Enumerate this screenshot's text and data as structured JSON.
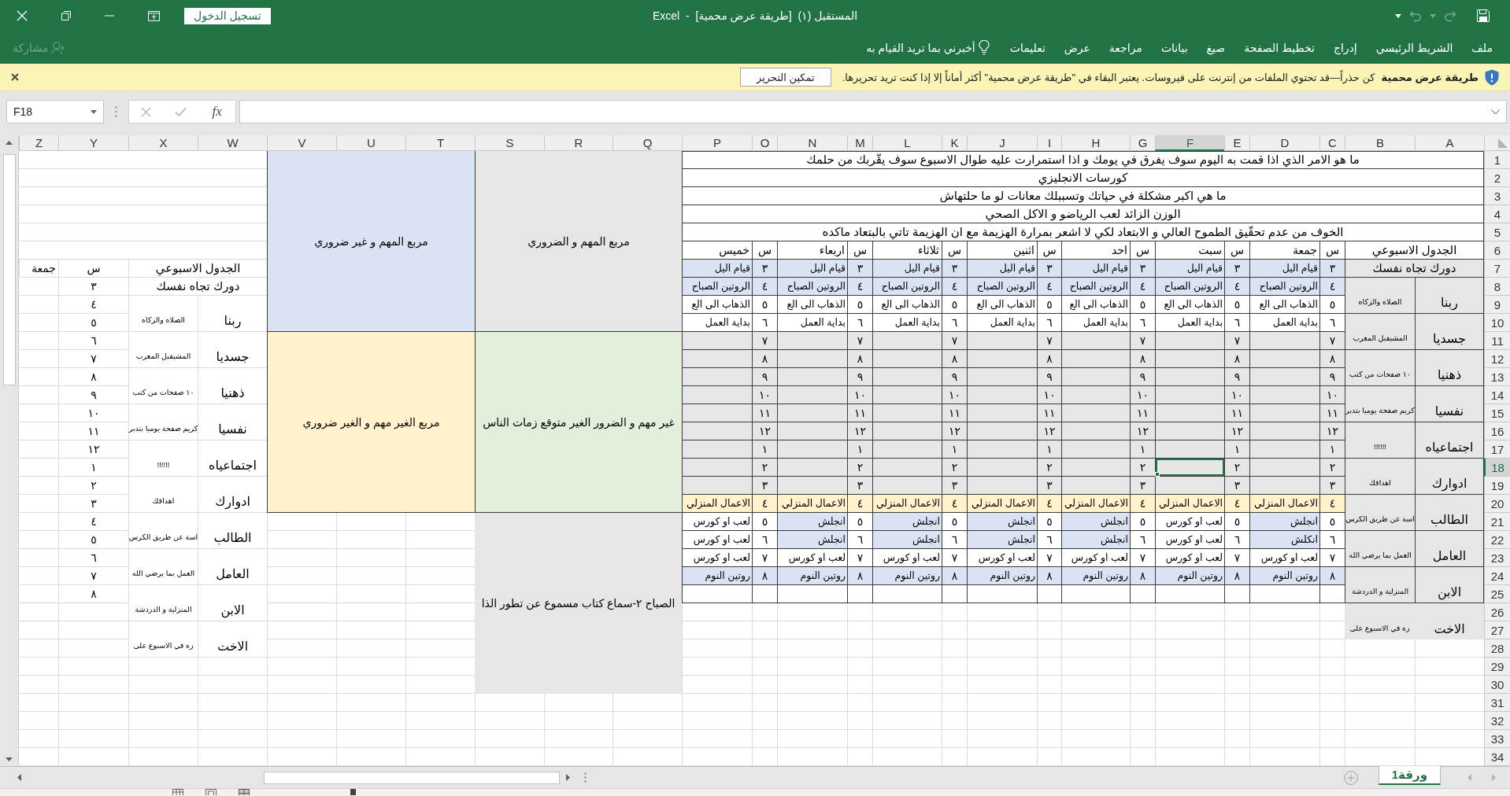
{
  "title_bar": {
    "sign_in": "تسجيل الدخول",
    "title": "المستقبل (١)  [طريقة عرض محمية]  -  Excel",
    "undo": {
      "disabled": true
    },
    "redo": {
      "disabled": true
    }
  },
  "ribbon": {
    "tabs": [
      {
        "label": "ملف",
        "selected": false
      },
      {
        "label": "الشريط الرئيسي",
        "selected": false
      },
      {
        "label": "إدراج",
        "selected": false
      },
      {
        "label": "تخطيط الصفحة",
        "selected": false
      },
      {
        "label": "صيغ",
        "selected": false
      },
      {
        "label": "بيانات",
        "selected": false
      },
      {
        "label": "مراجعة",
        "selected": false
      },
      {
        "label": "عرض",
        "selected": false
      },
      {
        "label": "تعليمات",
        "selected": false
      }
    ],
    "tell_me": "أخبرني بما تريد القيام به",
    "share": {
      "label": "مشاركة",
      "disabled": true
    }
  },
  "protected_view": {
    "title": "طريقة عرض محمية",
    "message": "كن حذراً—قد تحتوي الملفات من إنترنت على فيروسات. يعتبر البقاء في \"طريقة عرض محمية\" أكثر أماناً إلا إذا كنت تريد تحريرها.",
    "button": "تمكين التحرير"
  },
  "formula_bar": {
    "name_box": "F18",
    "cancel": {
      "disabled": true
    },
    "enter": {
      "disabled": true
    },
    "function_label": "fx"
  },
  "sheet": {
    "columns": [
      {
        "label": "A",
        "selected": false
      },
      {
        "label": "B",
        "selected": false
      },
      {
        "label": "C",
        "selected": false
      },
      {
        "label": "D",
        "selected": false
      },
      {
        "label": "E",
        "selected": false
      },
      {
        "label": "F",
        "selected": true
      },
      {
        "label": "G",
        "selected": false
      },
      {
        "label": "H",
        "selected": false
      },
      {
        "label": "I",
        "selected": false
      },
      {
        "label": "J",
        "selected": false
      },
      {
        "label": "K",
        "selected": false
      },
      {
        "label": "L",
        "selected": false
      },
      {
        "label": "M",
        "selected": false
      },
      {
        "label": "N",
        "selected": false
      },
      {
        "label": "O",
        "selected": false
      },
      {
        "label": "P",
        "selected": false
      },
      {
        "label": "Q",
        "selected": false
      },
      {
        "label": "R",
        "selected": false
      },
      {
        "label": "S",
        "selected": false
      },
      {
        "label": "T",
        "selected": false
      },
      {
        "label": "U",
        "selected": false
      },
      {
        "label": "V",
        "selected": false
      },
      {
        "label": "W",
        "selected": false
      },
      {
        "label": "X",
        "selected": false
      },
      {
        "label": "Y",
        "selected": false
      },
      {
        "label": "Z",
        "selected": false
      }
    ],
    "rows": [
      {
        "label": "1",
        "selected": false
      },
      {
        "label": "2",
        "selected": false
      },
      {
        "label": "3",
        "selected": false
      },
      {
        "label": "4",
        "selected": false
      },
      {
        "label": "5",
        "selected": false
      },
      {
        "label": "6",
        "selected": false
      },
      {
        "label": "7",
        "selected": false
      },
      {
        "label": "8",
        "selected": false
      },
      {
        "label": "9",
        "selected": false
      },
      {
        "label": "10",
        "selected": false
      },
      {
        "label": "11",
        "selected": false
      },
      {
        "label": "12",
        "selected": false
      },
      {
        "label": "13",
        "selected": false
      },
      {
        "label": "14",
        "selected": false
      },
      {
        "label": "15",
        "selected": false
      },
      {
        "label": "16",
        "selected": false
      },
      {
        "label": "17",
        "selected": false
      },
      {
        "label": "18",
        "selected": true
      },
      {
        "label": "19",
        "selected": false
      },
      {
        "label": "20",
        "selected": false
      },
      {
        "label": "21",
        "selected": false
      },
      {
        "label": "22",
        "selected": false
      },
      {
        "label": "23",
        "selected": false
      },
      {
        "label": "24",
        "selected": false
      },
      {
        "label": "25",
        "selected": false
      },
      {
        "label": "26",
        "selected": false
      },
      {
        "label": "27",
        "selected": false
      },
      {
        "label": "28",
        "selected": false
      },
      {
        "label": "29",
        "selected": false
      },
      {
        "label": "30",
        "selected": false
      },
      {
        "label": "31",
        "selected": false
      },
      {
        "label": "32",
        "selected": false
      },
      {
        "label": "33",
        "selected": false
      },
      {
        "label": "34",
        "selected": false
      }
    ],
    "questions": [
      "ما هو الامر الذي اذا قمت به اليوم سوف يفرق في يومك و اذا استمرارت عليه طوال الاسبوع سوف يقّربك من حلمك",
      "كورسات الانجليزي",
      "ما هي اكبر مشكلة في حياتك وتسببلك معانات لو ما حلتهاش",
      "الوزن الزائد لعب الرياضو و الاكل الصحي",
      "الخوف من عدم تحقّيق الطموح العالي و الابتعاد لكي لا اشعر بمرارة الهزيمة مع ان الهزيمة تاتي بالبتعاد ماكده"
    ],
    "schedule": {
      "title": "الجدول الاسبوعي",
      "subtitle": "دورك تجاه نفسك",
      "days": [
        {
          "hour_heading": "س",
          "name": "جمعة"
        },
        {
          "hour_heading": "س",
          "name": "سبت"
        },
        {
          "hour_heading": "س",
          "name": "احد"
        },
        {
          "hour_heading": "س",
          "name": "اثنين"
        },
        {
          "hour_heading": "س",
          "name": "ثلاثاء"
        },
        {
          "hour_heading": "س",
          "name": "اربعاء"
        },
        {
          "hour_heading": "س",
          "name": "خميس"
        }
      ],
      "rows": [
        {
          "cells": [
            {
              "kind": "hour",
              "text": "٣",
              "color": "#dae3f3"
            },
            {
              "kind": "activity",
              "text": "قيام اليل",
              "color": "#dae3f3"
            },
            {
              "kind": "hour",
              "text": "٣",
              "color": "#dae3f3"
            },
            {
              "kind": "activity",
              "text": "قيام اليل",
              "color": "#dae3f3"
            },
            {
              "kind": "hour",
              "text": "٣",
              "color": "#dae3f3"
            },
            {
              "kind": "activity",
              "text": "قيام اليل",
              "color": "#dae3f3"
            },
            {
              "kind": "hour",
              "text": "٣",
              "color": "#dae3f3"
            },
            {
              "kind": "activity",
              "text": "قيام اليل",
              "color": "#dae3f3"
            },
            {
              "kind": "hour",
              "text": "٣",
              "color": "#dae3f3"
            },
            {
              "kind": "activity",
              "text": "قيام اليل",
              "color": "#dae3f3"
            },
            {
              "kind": "hour",
              "text": "٣",
              "color": "#dae3f3"
            },
            {
              "kind": "activity",
              "text": "قيام اليل",
              "color": "#dae3f3"
            },
            {
              "kind": "hour",
              "text": "٣",
              "color": "#dae3f3"
            },
            {
              "kind": "activity",
              "text": "قيام اليل",
              "color": "#dae3f3"
            }
          ]
        },
        {
          "cells": [
            {
              "kind": "hour",
              "text": "٤",
              "color": "#dae3f3"
            },
            {
              "kind": "activity",
              "text": "الروتين الصباح",
              "color": "#dae3f3"
            },
            {
              "kind": "hour",
              "text": "٤",
              "color": "#dae3f3"
            },
            {
              "kind": "activity",
              "text": "الروتين الصباح",
              "color": "#dae3f3"
            },
            {
              "kind": "hour",
              "text": "٤",
              "color": "#dae3f3"
            },
            {
              "kind": "activity",
              "text": "الروتين الصباح",
              "color": "#dae3f3"
            },
            {
              "kind": "hour",
              "text": "٤",
              "color": "#dae3f3"
            },
            {
              "kind": "activity",
              "text": "الروتين الصباح",
              "color": "#dae3f3"
            },
            {
              "kind": "hour",
              "text": "٤",
              "color": "#dae3f3"
            },
            {
              "kind": "activity",
              "text": "الروتين الصباح",
              "color": "#dae3f3"
            },
            {
              "kind": "hour",
              "text": "٤",
              "color": "#dae3f3"
            },
            {
              "kind": "activity",
              "text": "الروتين الصباح",
              "color": "#dae3f3"
            },
            {
              "kind": "hour",
              "text": "٤",
              "color": "#dae3f3"
            },
            {
              "kind": "activity",
              "text": "الروتين الصباح",
              "color": "#dae3f3"
            }
          ]
        },
        {
          "cells": [
            {
              "kind": "hour",
              "text": "٥",
              "color": "#ffffff"
            },
            {
              "kind": "activity",
              "text": "الذهاب الى الع",
              "color": "#ffffff"
            },
            {
              "kind": "hour",
              "text": "٥",
              "color": "#ffffff"
            },
            {
              "kind": "activity",
              "text": "الذهاب الى الع",
              "color": "#ffffff"
            },
            {
              "kind": "hour",
              "text": "٥",
              "color": "#ffffff"
            },
            {
              "kind": "activity",
              "text": "الذهاب الى الع",
              "color": "#ffffff"
            },
            {
              "kind": "hour",
              "text": "٥",
              "color": "#ffffff"
            },
            {
              "kind": "activity",
              "text": "الذهاب الى الع",
              "color": "#ffffff"
            },
            {
              "kind": "hour",
              "text": "٥",
              "color": "#ffffff"
            },
            {
              "kind": "activity",
              "text": "الذهاب الى الع",
              "color": "#ffffff"
            },
            {
              "kind": "hour",
              "text": "٥",
              "color": "#ffffff"
            },
            {
              "kind": "activity",
              "text": "الذهاب الى الع",
              "color": "#ffffff"
            },
            {
              "kind": "hour",
              "text": "٥",
              "color": "#ffffff"
            },
            {
              "kind": "activity",
              "text": "الذهاب الى الع",
              "color": "#ffffff"
            }
          ]
        },
        {
          "cells": [
            {
              "kind": "hour",
              "text": "٦",
              "color": "#ffffff"
            },
            {
              "kind": "activity",
              "text": "بداية العمل",
              "color": "#ffffff"
            },
            {
              "kind": "hour",
              "text": "٦",
              "color": "#ffffff"
            },
            {
              "kind": "activity",
              "text": "بداية العمل",
              "color": "#ffffff"
            },
            {
              "kind": "hour",
              "text": "٦",
              "color": "#ffffff"
            },
            {
              "kind": "activity",
              "text": "بداية العمل",
              "color": "#ffffff"
            },
            {
              "kind": "hour",
              "text": "٦",
              "color": "#ffffff"
            },
            {
              "kind": "activity",
              "text": "بداية العمل",
              "color": "#ffffff"
            },
            {
              "kind": "hour",
              "text": "٦",
              "color": "#ffffff"
            },
            {
              "kind": "activity",
              "text": "بداية العمل",
              "color": "#ffffff"
            },
            {
              "kind": "hour",
              "text": "٦",
              "color": "#ffffff"
            },
            {
              "kind": "activity",
              "text": "بداية العمل",
              "color": "#ffffff"
            },
            {
              "kind": "hour",
              "text": "٦",
              "color": "#ffffff"
            },
            {
              "kind": "activity",
              "text": "بداية العمل",
              "color": "#ffffff"
            }
          ]
        },
        {
          "cells": [
            {
              "kind": "hour",
              "text": "٧",
              "color": "#e7e6e6"
            },
            {
              "kind": "activity",
              "color": "#e7e6e6"
            },
            {
              "kind": "hour",
              "text": "٧",
              "color": "#e7e6e6"
            },
            {
              "kind": "activity",
              "color": "#e7e6e6"
            },
            {
              "kind": "hour",
              "text": "٧",
              "color": "#e7e6e6"
            },
            {
              "kind": "activity",
              "color": "#e7e6e6"
            },
            {
              "kind": "hour",
              "text": "٧",
              "color": "#e7e6e6"
            },
            {
              "kind": "activity",
              "color": "#e7e6e6"
            },
            {
              "kind": "hour",
              "text": "٧",
              "color": "#e7e6e6"
            },
            {
              "kind": "activity",
              "color": "#e7e6e6"
            },
            {
              "kind": "hour",
              "text": "٧",
              "color": "#e7e6e6"
            },
            {
              "kind": "activity",
              "color": "#e7e6e6"
            },
            {
              "kind": "hour",
              "text": "٧",
              "color": "#e7e6e6"
            },
            {
              "kind": "activity",
              "color": "#e7e6e6"
            }
          ]
        },
        {
          "cells": [
            {
              "kind": "hour",
              "text": "٨",
              "color": "#e7e6e6"
            },
            {
              "kind": "activity",
              "color": "#e7e6e6"
            },
            {
              "kind": "hour",
              "text": "٨",
              "color": "#e7e6e6"
            },
            {
              "kind": "activity",
              "color": "#e7e6e6"
            },
            {
              "kind": "hour",
              "text": "٨",
              "color": "#e7e6e6"
            },
            {
              "kind": "activity",
              "color": "#e7e6e6"
            },
            {
              "kind": "hour",
              "text": "٨",
              "color": "#e7e6e6"
            },
            {
              "kind": "activity",
              "color": "#e7e6e6"
            },
            {
              "kind": "hour",
              "text": "٨",
              "color": "#e7e6e6"
            },
            {
              "kind": "activity",
              "color": "#e7e6e6"
            },
            {
              "kind": "hour",
              "text": "٨",
              "color": "#e7e6e6"
            },
            {
              "kind": "activity",
              "color": "#e7e6e6"
            },
            {
              "kind": "hour",
              "text": "٨",
              "color": "#e7e6e6"
            },
            {
              "kind": "activity",
              "color": "#e7e6e6"
            }
          ]
        },
        {
          "cells": [
            {
              "kind": "hour",
              "text": "٩",
              "color": "#e7e6e6"
            },
            {
              "kind": "activity",
              "color": "#e7e6e6"
            },
            {
              "kind": "hour",
              "text": "٩",
              "color": "#e7e6e6"
            },
            {
              "kind": "activity",
              "color": "#e7e6e6"
            },
            {
              "kind": "hour",
              "text": "٩",
              "color": "#e7e6e6"
            },
            {
              "kind": "activity",
              "color": "#e7e6e6"
            },
            {
              "kind": "hour",
              "text": "٩",
              "color": "#e7e6e6"
            },
            {
              "kind": "activity",
              "color": "#e7e6e6"
            },
            {
              "kind": "hour",
              "text": "٩",
              "color": "#e7e6e6"
            },
            {
              "kind": "activity",
              "color": "#e7e6e6"
            },
            {
              "kind": "hour",
              "text": "٩",
              "color": "#e7e6e6"
            },
            {
              "kind": "activity",
              "color": "#e7e6e6"
            },
            {
              "kind": "hour",
              "text": "٩",
              "color": "#e7e6e6"
            },
            {
              "kind": "activity",
              "color": "#e7e6e6"
            }
          ]
        },
        {
          "cells": [
            {
              "kind": "hour",
              "text": "١٠",
              "color": "#e7e6e6"
            },
            {
              "kind": "activity",
              "color": "#e7e6e6"
            },
            {
              "kind": "hour",
              "text": "١٠",
              "color": "#e7e6e6"
            },
            {
              "kind": "activity",
              "color": "#e7e6e6"
            },
            {
              "kind": "hour",
              "text": "١٠",
              "color": "#e7e6e6"
            },
            {
              "kind": "activity",
              "color": "#e7e6e6"
            },
            {
              "kind": "hour",
              "text": "١٠",
              "color": "#e7e6e6"
            },
            {
              "kind": "activity",
              "color": "#e7e6e6"
            },
            {
              "kind": "hour",
              "text": "١٠",
              "color": "#e7e6e6"
            },
            {
              "kind": "activity",
              "color": "#e7e6e6"
            },
            {
              "kind": "hour",
              "text": "١٠",
              "color": "#e7e6e6"
            },
            {
              "kind": "activity",
              "color": "#e7e6e6"
            },
            {
              "kind": "hour",
              "text": "١٠",
              "color": "#e7e6e6"
            },
            {
              "kind": "activity",
              "color": "#e7e6e6"
            }
          ]
        },
        {
          "cells": [
            {
              "kind": "hour",
              "text": "١١",
              "color": "#e7e6e6"
            },
            {
              "kind": "activity",
              "color": "#e7e6e6"
            },
            {
              "kind": "hour",
              "text": "١١",
              "color": "#e7e6e6"
            },
            {
              "kind": "activity",
              "color": "#e7e6e6"
            },
            {
              "kind": "hour",
              "text": "١١",
              "color": "#e7e6e6"
            },
            {
              "kind": "activity",
              "color": "#e7e6e6"
            },
            {
              "kind": "hour",
              "text": "١١",
              "color": "#e7e6e6"
            },
            {
              "kind": "activity",
              "color": "#e7e6e6"
            },
            {
              "kind": "hour",
              "text": "١١",
              "color": "#e7e6e6"
            },
            {
              "kind": "activity",
              "color": "#e7e6e6"
            },
            {
              "kind": "hour",
              "text": "١١",
              "color": "#e7e6e6"
            },
            {
              "kind": "activity",
              "color": "#e7e6e6"
            },
            {
              "kind": "hour",
              "text": "١١",
              "color": "#e7e6e6"
            },
            {
              "kind": "activity",
              "color": "#e7e6e6"
            }
          ]
        },
        {
          "cells": [
            {
              "kind": "hour",
              "text": "١٢",
              "color": "#e7e6e6"
            },
            {
              "kind": "activity",
              "color": "#e7e6e6"
            },
            {
              "kind": "hour",
              "text": "١٢",
              "color": "#e7e6e6"
            },
            {
              "kind": "activity",
              "color": "#e7e6e6"
            },
            {
              "kind": "hour",
              "text": "١٢",
              "color": "#e7e6e6"
            },
            {
              "kind": "activity",
              "color": "#e7e6e6"
            },
            {
              "kind": "hour",
              "text": "١٢",
              "color": "#e7e6e6"
            },
            {
              "kind": "activity",
              "color": "#e7e6e6"
            },
            {
              "kind": "hour",
              "text": "١٢",
              "color": "#e7e6e6"
            },
            {
              "kind": "activity",
              "color": "#e7e6e6"
            },
            {
              "kind": "hour",
              "text": "١٢",
              "color": "#e7e6e6"
            },
            {
              "kind": "activity",
              "color": "#e7e6e6"
            },
            {
              "kind": "hour",
              "text": "١٢",
              "color": "#e7e6e6"
            },
            {
              "kind": "activity",
              "color": "#e7e6e6"
            }
          ]
        },
        {
          "cells": [
            {
              "kind": "hour",
              "text": "١",
              "color": "#e7e6e6"
            },
            {
              "kind": "activity",
              "color": "#e7e6e6"
            },
            {
              "kind": "hour",
              "text": "١",
              "color": "#e7e6e6"
            },
            {
              "kind": "activity",
              "color": "#e7e6e6"
            },
            {
              "kind": "hour",
              "text": "١",
              "color": "#e7e6e6"
            },
            {
              "kind": "activity",
              "color": "#e7e6e6"
            },
            {
              "kind": "hour",
              "text": "١",
              "color": "#e7e6e6"
            },
            {
              "kind": "activity",
              "color": "#e7e6e6"
            },
            {
              "kind": "hour",
              "text": "١",
              "color": "#e7e6e6"
            },
            {
              "kind": "activity",
              "color": "#e7e6e6"
            },
            {
              "kind": "hour",
              "text": "١",
              "color": "#e7e6e6"
            },
            {
              "kind": "activity",
              "color": "#e7e6e6"
            },
            {
              "kind": "hour",
              "text": "١",
              "color": "#e7e6e6"
            },
            {
              "kind": "activity",
              "color": "#e7e6e6"
            }
          ]
        },
        {
          "cells": [
            {
              "kind": "hour",
              "text": "٢",
              "color": "#e7e6e6"
            },
            {
              "kind": "activity",
              "color": "#e7e6e6"
            },
            {
              "kind": "hour",
              "text": "٢",
              "color": "#e7e6e6"
            },
            {
              "kind": "activity",
              "color": "#e7e6e6"
            },
            {
              "kind": "hour",
              "text": "٢",
              "color": "#e7e6e6"
            },
            {
              "kind": "activity",
              "color": "#e7e6e6"
            },
            {
              "kind": "hour",
              "text": "٢",
              "color": "#e7e6e6"
            },
            {
              "kind": "activity",
              "color": "#e7e6e6"
            },
            {
              "kind": "hour",
              "text": "٢",
              "color": "#e7e6e6"
            },
            {
              "kind": "activity",
              "color": "#e7e6e6"
            },
            {
              "kind": "hour",
              "text": "٢",
              "color": "#e7e6e6"
            },
            {
              "kind": "activity",
              "color": "#e7e6e6"
            },
            {
              "kind": "hour",
              "text": "٢",
              "color": "#e7e6e6"
            },
            {
              "kind": "activity",
              "color": "#e7e6e6"
            }
          ]
        },
        {
          "cells": [
            {
              "kind": "hour",
              "text": "٣",
              "color": "#e7e6e6"
            },
            {
              "kind": "activity",
              "color": "#e7e6e6"
            },
            {
              "kind": "hour",
              "text": "٣",
              "color": "#e7e6e6"
            },
            {
              "kind": "activity",
              "color": "#e7e6e6"
            },
            {
              "kind": "hour",
              "text": "٣",
              "color": "#e7e6e6"
            },
            {
              "kind": "activity",
              "color": "#e7e6e6"
            },
            {
              "kind": "hour",
              "text": "٣",
              "color": "#e7e6e6"
            },
            {
              "kind": "activity",
              "color": "#e7e6e6"
            },
            {
              "kind": "hour",
              "text": "٣",
              "color": "#e7e6e6"
            },
            {
              "kind": "activity",
              "color": "#e7e6e6"
            },
            {
              "kind": "hour",
              "text": "٣",
              "color": "#e7e6e6"
            },
            {
              "kind": "activity",
              "color": "#e7e6e6"
            },
            {
              "kind": "hour",
              "text": "٣",
              "color": "#e7e6e6"
            },
            {
              "kind": "activity",
              "color": "#e7e6e6"
            }
          ]
        },
        {
          "cells": [
            {
              "kind": "hour",
              "text": "٤",
              "color": "#fff2cc"
            },
            {
              "kind": "activity",
              "text": "الاعمال المنزلي",
              "color": "#fff2cc"
            },
            {
              "kind": "hour",
              "text": "٤",
              "color": "#fff2cc"
            },
            {
              "kind": "activity",
              "text": "الاعمال المنزلي",
              "color": "#fff2cc"
            },
            {
              "kind": "hour",
              "text": "٤",
              "color": "#fff2cc"
            },
            {
              "kind": "activity",
              "text": "الاعمال المنزلي",
              "color": "#fff2cc"
            },
            {
              "kind": "hour",
              "text": "٤",
              "color": "#fff2cc"
            },
            {
              "kind": "activity",
              "text": "الاعمال المنزلي",
              "color": "#fff2cc"
            },
            {
              "kind": "hour",
              "text": "٤",
              "color": "#fff2cc"
            },
            {
              "kind": "activity",
              "text": "الاعمال المنزلي",
              "color": "#fff2cc"
            },
            {
              "kind": "hour",
              "text": "٤",
              "color": "#fff2cc"
            },
            {
              "kind": "activity",
              "text": "الاعمال المنزلي",
              "color": "#fff2cc"
            },
            {
              "kind": "hour",
              "text": "٤",
              "color": "#fff2cc"
            },
            {
              "kind": "activity",
              "text": "الاعمال المنزلي",
              "color": "#fff2cc"
            }
          ]
        },
        {
          "cells": [
            {
              "kind": "hour",
              "text": "٥",
              "color": "#ffffff"
            },
            {
              "kind": "activity",
              "text": "انجلش",
              "color": "#dae3f3"
            },
            {
              "kind": "hour",
              "text": "٥",
              "color": "#ffffff"
            },
            {
              "kind": "activity",
              "text": "لعب او كورس",
              "color": "#ffffff"
            },
            {
              "kind": "hour",
              "text": "٥",
              "color": "#ffffff"
            },
            {
              "kind": "activity",
              "text": "انجلش",
              "color": "#dae3f3"
            },
            {
              "kind": "hour",
              "text": "٥",
              "color": "#ffffff"
            },
            {
              "kind": "activity",
              "text": "انجلش",
              "color": "#dae3f3"
            },
            {
              "kind": "hour",
              "text": "٥",
              "color": "#ffffff"
            },
            {
              "kind": "activity",
              "text": "انجلش",
              "color": "#dae3f3"
            },
            {
              "kind": "hour",
              "text": "٥",
              "color": "#ffffff"
            },
            {
              "kind": "activity",
              "text": "انجلش",
              "color": "#dae3f3"
            },
            {
              "kind": "hour",
              "text": "٥",
              "color": "#ffffff"
            },
            {
              "kind": "activity",
              "text": "لعب او كورس",
              "color": "#ffffff"
            }
          ]
        },
        {
          "cells": [
            {
              "kind": "hour",
              "text": "٦",
              "color": "#ffffff"
            },
            {
              "kind": "activity",
              "text": "انكلش",
              "color": "#dae3f3"
            },
            {
              "kind": "hour",
              "text": "٦",
              "color": "#ffffff"
            },
            {
              "kind": "activity",
              "text": "لعب او كورس",
              "color": "#ffffff"
            },
            {
              "kind": "hour",
              "text": "٦",
              "color": "#ffffff"
            },
            {
              "kind": "activity",
              "text": "انجلش",
              "color": "#dae3f3"
            },
            {
              "kind": "hour",
              "text": "٦",
              "color": "#ffffff"
            },
            {
              "kind": "activity",
              "text": "انجلش",
              "color": "#dae3f3"
            },
            {
              "kind": "hour",
              "text": "٦",
              "color": "#ffffff"
            },
            {
              "kind": "activity",
              "text": "انجلش",
              "color": "#dae3f3"
            },
            {
              "kind": "hour",
              "text": "٦",
              "color": "#ffffff"
            },
            {
              "kind": "activity",
              "text": "انجلش",
              "color": "#dae3f3"
            },
            {
              "kind": "hour",
              "text": "٦",
              "color": "#ffffff"
            },
            {
              "kind": "activity",
              "text": "لعب او كورس",
              "color": "#ffffff"
            }
          ]
        },
        {
          "cells": [
            {
              "kind": "hour",
              "text": "٧",
              "color": "#ffffff"
            },
            {
              "kind": "activity",
              "text": "لعب او كورس",
              "color": "#ffffff"
            },
            {
              "kind": "hour",
              "text": "٧",
              "color": "#ffffff"
            },
            {
              "kind": "activity",
              "text": "لعب او كورس",
              "color": "#ffffff"
            },
            {
              "kind": "hour",
              "text": "٧",
              "color": "#ffffff"
            },
            {
              "kind": "activity",
              "text": "لعب او كورس",
              "color": "#ffffff"
            },
            {
              "kind": "hour",
              "text": "٧",
              "color": "#ffffff"
            },
            {
              "kind": "activity",
              "text": "لعب او كورس",
              "color": "#ffffff"
            },
            {
              "kind": "hour",
              "text": "٧",
              "color": "#ffffff"
            },
            {
              "kind": "activity",
              "text": "لعب او كورس",
              "color": "#ffffff"
            },
            {
              "kind": "hour",
              "text": "٧",
              "color": "#ffffff"
            },
            {
              "kind": "activity",
              "text": "لعب او كورس",
              "color": "#ffffff"
            },
            {
              "kind": "hour",
              "text": "٧",
              "color": "#ffffff"
            },
            {
              "kind": "activity",
              "text": "لعب او كورس",
              "color": "#ffffff"
            }
          ]
        },
        {
          "cells": [
            {
              "kind": "hour",
              "text": "٨",
              "color": "#dae3f3"
            },
            {
              "kind": "activity",
              "text": "روتين النوم",
              "color": "#dae3f3"
            },
            {
              "kind": "hour",
              "text": "٨",
              "color": "#dae3f3"
            },
            {
              "kind": "activity",
              "text": "روتين النوم",
              "color": "#dae3f3"
            },
            {
              "kind": "hour",
              "text": "٨",
              "color": "#dae3f3"
            },
            {
              "kind": "activity",
              "text": "روتين النوم",
              "color": "#dae3f3"
            },
            {
              "kind": "hour",
              "text": "٨",
              "color": "#dae3f3"
            },
            {
              "kind": "activity",
              "text": "روتين النوم",
              "color": "#dae3f3"
            },
            {
              "kind": "hour",
              "text": "٨",
              "color": "#dae3f3"
            },
            {
              "kind": "activity",
              "text": "روتين النوم",
              "color": "#dae3f3"
            },
            {
              "kind": "hour",
              "text": "٨",
              "color": "#dae3f3"
            },
            {
              "kind": "activity",
              "text": "روتين النوم",
              "color": "#dae3f3"
            },
            {
              "kind": "hour",
              "text": "٨",
              "color": "#dae3f3"
            },
            {
              "kind": "activity",
              "text": "روتين النوم",
              "color": "#dae3f3"
            }
          ]
        }
      ],
      "roles": [
        {
          "role": "ربنا",
          "goal": "الصلاه والزكاه"
        },
        {
          "role": "جسديا",
          "goal": "المشيقبل المغرب"
        },
        {
          "role": "ذهنيا",
          "goal": "١٠ صفحات من كتب"
        },
        {
          "role": "نفسيا",
          "goal": "كريم صفحة يوميا بتدبر"
        },
        {
          "role": "اجتماعياه",
          "goal": "!!!!!!"
        },
        {
          "role": "ادوارك",
          "goal": "اهدافك"
        },
        {
          "role": "الطالب",
          "goal": "اسة عن طريق الكرس"
        },
        {
          "role": "العامل",
          "goal": "العمل بما يرضي الله"
        },
        {
          "role": "الابن",
          "goal": "المنزلية و الدردشة"
        },
        {
          "role": "الاخت",
          "goal": "ره في الاسبوع على"
        }
      ]
    },
    "quadrants": [
      {
        "kind": "quadrant",
        "text": "مربع المهم و الضروري",
        "color": "#e7e6e6"
      },
      {
        "kind": "quadrant",
        "text": "مربع المهم و غير ضروري",
        "color": "#dae3f3"
      },
      {
        "kind": "quadrant",
        "text": "غير مهم و الضرور الغير متوقع زمات الناس",
        "color": "#e2efda"
      },
      {
        "kind": "quadrant",
        "text": "مربع الغير مهم و الغير ضروري",
        "color": "#fff2cc"
      },
      {
        "kind": "note",
        "text": "الصباح ٢-سماع كتاب مسموع عن تطور الذا",
        "color": "#e7e6e6"
      }
    ],
    "copy": {
      "title": "الجدول الاسبوعي",
      "hour_heading": "س",
      "day": "جمعة",
      "subtitle": "دورك تجاه نفسك",
      "hours": [
        "٣",
        "٤",
        "٥",
        "٦",
        "٧",
        "٨",
        "٩",
        "١٠",
        "١١",
        "١٢",
        "١",
        "٢",
        "٣",
        "٤",
        "٥",
        "٦",
        "٧",
        "٨"
      ],
      "roles": [
        {
          "role": "ربنا",
          "goal": "الصلاه والزكاه"
        },
        {
          "role": "جسديا",
          "goal": "المشيقبل المغرب"
        },
        {
          "role": "ذهنيا",
          "goal": "١٠ صفحات من كتب"
        },
        {
          "role": "نفسيا",
          "goal": "كريم صفحة يوميا بتدبر"
        },
        {
          "role": "اجتماعياه",
          "goal": "!!!!!!"
        },
        {
          "role": "ادوارك",
          "goal": "اهدافك"
        },
        {
          "role": "الطالب",
          "goal": "اسة عن طريق الكرس"
        },
        {
          "role": "العامل",
          "goal": "العمل بما يرضي الله"
        },
        {
          "role": "الابن",
          "goal": "المنزلية و الدردشة"
        },
        {
          "role": "الاخت",
          "goal": "ره في الاسبوع على"
        }
      ]
    }
  },
  "sheet_tabs": [
    {
      "label": "ورقة1",
      "selected": true
    }
  ],
  "sheet_nav": {
    "disabled": true
  }
}
